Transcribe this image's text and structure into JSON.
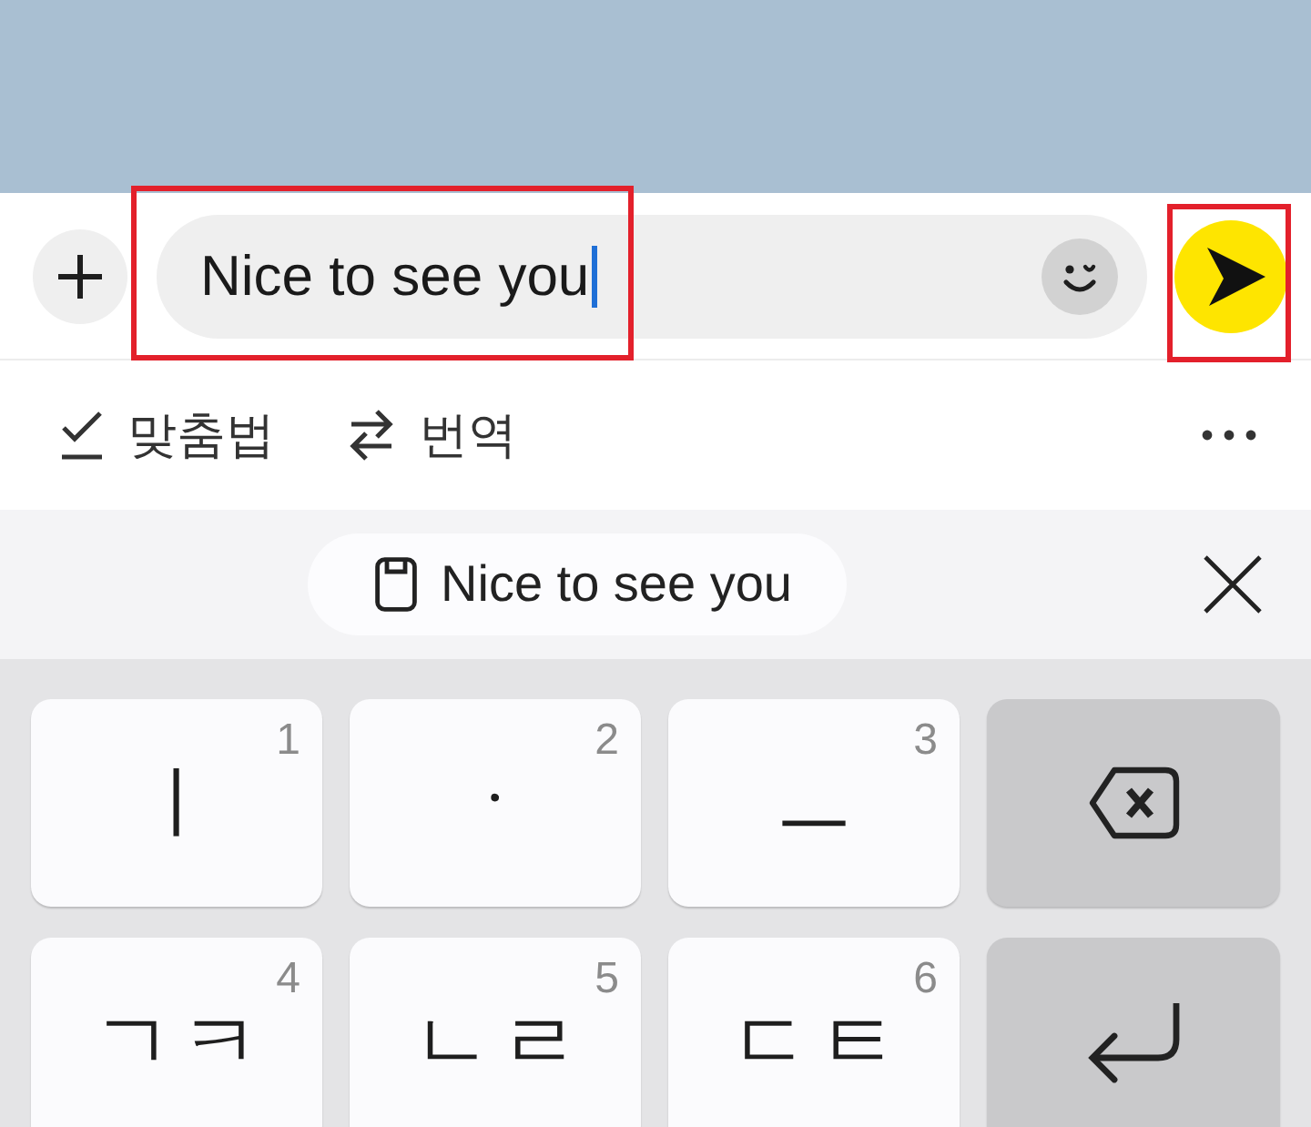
{
  "message_bar": {
    "value": "Nice to see you",
    "focused": true,
    "highlighted": true
  },
  "send_button": {
    "highlighted": true
  },
  "toolbar": {
    "items": [
      {
        "kind": "spellcheck",
        "label": "맞춤법"
      },
      {
        "kind": "translate",
        "label": "번역"
      }
    ]
  },
  "clipboard_suggestion": {
    "text": "Nice to see you"
  },
  "keyboard": {
    "rows": [
      [
        {
          "kind": "letter",
          "label": "ㅣ",
          "hint": "1"
        },
        {
          "kind": "letter",
          "label": "ㆍ",
          "hint": "2"
        },
        {
          "kind": "letter",
          "label": "ㅡ",
          "hint": "3"
        },
        {
          "kind": "backspace"
        }
      ],
      [
        {
          "kind": "letter",
          "label": "ㄱㅋ",
          "hint": "4"
        },
        {
          "kind": "letter",
          "label": "ㄴㄹ",
          "hint": "5"
        },
        {
          "kind": "letter",
          "label": "ㄷㅌ",
          "hint": "6"
        },
        {
          "kind": "enter"
        }
      ]
    ]
  }
}
